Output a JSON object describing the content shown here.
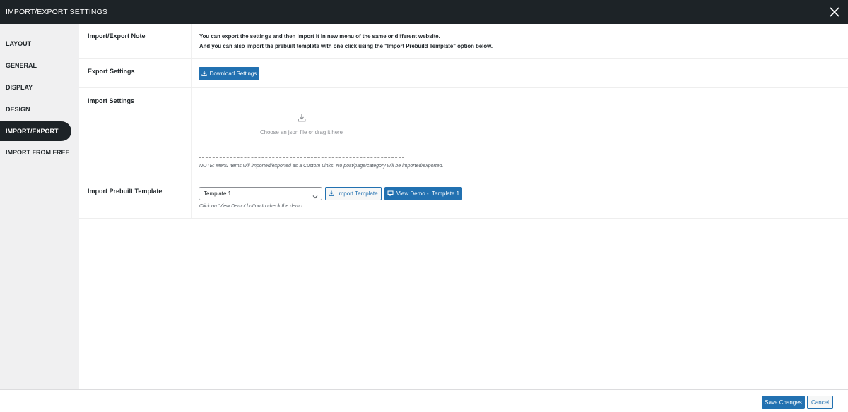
{
  "header": {
    "title": "IMPORT/EXPORT SETTINGS",
    "close_icon": "close-icon"
  },
  "sidebar": {
    "items": [
      {
        "label": "LAYOUT",
        "active": false
      },
      {
        "label": "GENERAL",
        "active": false
      },
      {
        "label": "DISPLAY",
        "active": false
      },
      {
        "label": "DESIGN",
        "active": false
      },
      {
        "label": "IMPORT/EXPORT",
        "active": true
      },
      {
        "label": "IMPORT FROM FREE",
        "active": false
      }
    ]
  },
  "main": {
    "note": {
      "label": "Import/Export Note",
      "line1": "You can export the settings and then import it in new menu of the same or different website.",
      "line2": "And you can also import the prebuilt template with one click using the \"Import Prebuild Template\" option below."
    },
    "export": {
      "label": "Export Settings",
      "button": "Download Settings",
      "icon": "download-icon"
    },
    "import": {
      "label": "Import Settings",
      "dropzone_text": "Choose an json file or drag it here",
      "dropzone_icon": "upload-tray-icon",
      "note": "NOTE: Menu Items will imported/exported as a Custom Links. No post/page/category will be imported/exported."
    },
    "prebuilt": {
      "label": "Import Prebuilt Template",
      "select_value": "Template 1",
      "import_button": "Import Template",
      "demo_button": "View Demo -  Template 1",
      "hint": "Click on 'View Demo' button to check the demo."
    }
  },
  "footer": {
    "save_label": "Save Changes",
    "cancel_label": "Cancel"
  },
  "colors": {
    "header_bg": "#1d2327",
    "primary": "#2271b1",
    "sidebar_bg": "#f0f0f1"
  }
}
